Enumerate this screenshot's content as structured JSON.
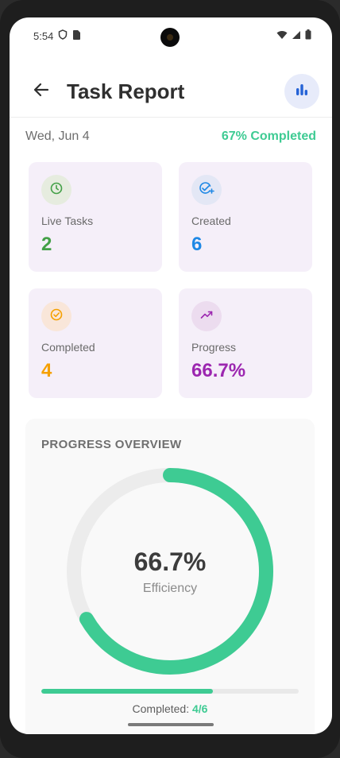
{
  "status_bar": {
    "time": "5:54"
  },
  "app_bar": {
    "title": "Task Report"
  },
  "header": {
    "date": "Wed, Jun 4",
    "completed_percent": "67% Completed"
  },
  "stats": [
    {
      "label": "Live Tasks",
      "value": "2",
      "icon": "clock-icon",
      "color": "#43a047",
      "icon_bg": "#e6ecdf"
    },
    {
      "label": "Created",
      "value": "6",
      "icon": "add-task-icon",
      "color": "#1e88e5",
      "icon_bg": "#e3e7f5"
    },
    {
      "label": "Completed",
      "value": "4",
      "icon": "check-circle-icon",
      "color": "#f5a000",
      "icon_bg": "#f9e6d9"
    },
    {
      "label": "Progress",
      "value": "66.7%",
      "icon": "trending-up-icon",
      "color": "#9c27b0",
      "icon_bg": "#ecdcef"
    }
  ],
  "overview": {
    "title": "PROGRESS OVERVIEW",
    "percent_text": "66.7%",
    "caption": "Efficiency",
    "progress_fraction": 0.667,
    "completed_label": "Completed:",
    "completed_value": "4/6"
  },
  "colors": {
    "accent": "#3ecb93",
    "ring_track": "#ececec"
  }
}
